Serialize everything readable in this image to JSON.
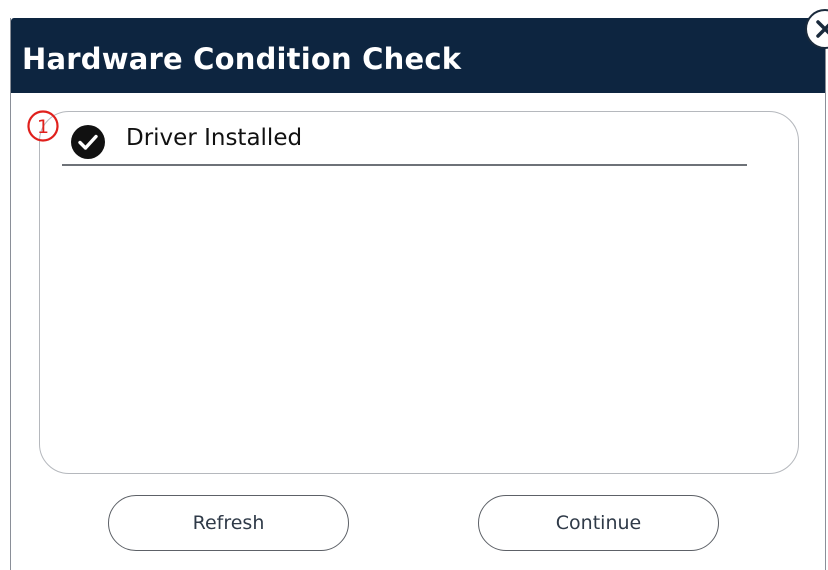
{
  "dialog": {
    "title": "Hardware Condition Check",
    "close_icon": "close-icon"
  },
  "checklist": {
    "marker": "①",
    "items": [
      {
        "label": "Driver Installed",
        "status": "checked",
        "icon": "checkmark-circle-icon"
      }
    ]
  },
  "buttons": {
    "refresh_label": "Refresh",
    "continue_label": "Continue"
  },
  "colors": {
    "titlebar": "#0d2540",
    "marker": "#e0201c",
    "check_circle": "#111111"
  }
}
